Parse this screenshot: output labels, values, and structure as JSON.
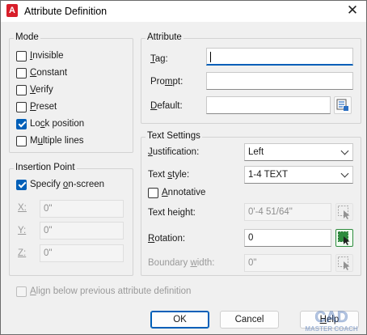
{
  "window": {
    "title": "Attribute Definition",
    "app_icon_letter": "A",
    "close_glyph": "✕"
  },
  "mode": {
    "title": "Mode",
    "invisible": {
      "pre": "",
      "u": "I",
      "post": "nvisible",
      "checked": false
    },
    "constant": {
      "pre": "",
      "u": "C",
      "post": "onstant",
      "checked": false
    },
    "verify": {
      "pre": "",
      "u": "V",
      "post": "erify",
      "checked": false
    },
    "preset": {
      "pre": "",
      "u": "P",
      "post": "reset",
      "checked": false
    },
    "lock_position": {
      "pre": "Lo",
      "u": "c",
      "post": "k position",
      "checked": true
    },
    "multiple_lines": {
      "pre": "M",
      "u": "u",
      "post": "ltiple lines",
      "checked": false
    }
  },
  "insertion_point": {
    "title": "Insertion Point",
    "specify_on_screen": {
      "pre": "Specify ",
      "u": "o",
      "post": "n-screen",
      "checked": true
    },
    "x_label": "X:",
    "x_value": "0\"",
    "y_label": "Y:",
    "y_value": "0\"",
    "z_label": "Z:",
    "z_value": "0\""
  },
  "attribute": {
    "title": "Attribute",
    "tag_label_pre": "",
    "tag_label_u": "T",
    "tag_label_post": "ag:",
    "tag_value": "",
    "prompt_label_pre": "Pro",
    "prompt_label_u": "m",
    "prompt_label_post": "pt:",
    "prompt_value": "",
    "default_label_pre": "",
    "default_label_u": "D",
    "default_label_post": "efault:",
    "default_value": "",
    "insert_field_icon": "insert-field-icon"
  },
  "text_settings": {
    "title": "Text Settings",
    "justification_label_pre": "",
    "justification_label_u": "J",
    "justification_label_post": "ustification:",
    "justification_value": "Left",
    "text_style_label_pre": "Text ",
    "text_style_label_u": "s",
    "text_style_label_post": "tyle:",
    "text_style_value": "1-4 TEXT",
    "annotative": {
      "pre": "",
      "u": "A",
      "post": "nnotative",
      "checked": false
    },
    "text_height_label_pre": "Text hei",
    "text_height_label_u": "g",
    "text_height_label_post": "ht:",
    "text_height_value": "0'-4 51/64\"",
    "rotation_label_pre": "",
    "rotation_label_u": "R",
    "rotation_label_post": "otation:",
    "rotation_value": "0",
    "boundary_width_label_pre": "Boundary ",
    "boundary_width_label_u": "w",
    "boundary_width_label_post": "idth:",
    "boundary_width_value": "0\""
  },
  "align_below": {
    "pre": "",
    "u": "A",
    "post": "lign below previous attribute definition",
    "checked": false
  },
  "buttons": {
    "ok": "OK",
    "cancel": "Cancel",
    "help_pre": "",
    "help_u": "H",
    "help_post": "elp"
  },
  "watermark": {
    "line1": "CAD",
    "line2": "MASTER COACH"
  },
  "colors": {
    "accent": "#005fb8",
    "app_icon": "#d81e2a",
    "pick_active": "#2e8b3e"
  }
}
